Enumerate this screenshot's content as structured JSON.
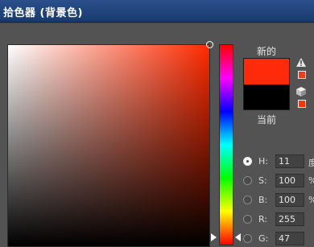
{
  "window": {
    "title": "拾色器 (背景色)"
  },
  "preview": {
    "new_label": "新的",
    "current_label": "当前",
    "new_color": "#ff2a0a",
    "current_color": "#000000"
  },
  "gamut_warning": {
    "icon": "warning-triangle-icon",
    "swatch_color": "#f03a1e"
  },
  "web_safe": {
    "icon": "cube-icon",
    "swatch_color": "#ff3300"
  },
  "picker": {
    "hue_color": "#ff2a00"
  },
  "fields": [
    {
      "key": "H",
      "label": "H:",
      "value": "11",
      "unit": "度",
      "selected": true
    },
    {
      "key": "S",
      "label": "S:",
      "value": "100",
      "unit": "%",
      "selected": false
    },
    {
      "key": "B",
      "label": "B:",
      "value": "100",
      "unit": "%",
      "selected": false
    },
    {
      "key": "R",
      "label": "R:",
      "value": "255",
      "unit": "",
      "selected": false
    },
    {
      "key": "G",
      "label": "G:",
      "value": "47",
      "unit": "",
      "selected": false
    }
  ]
}
